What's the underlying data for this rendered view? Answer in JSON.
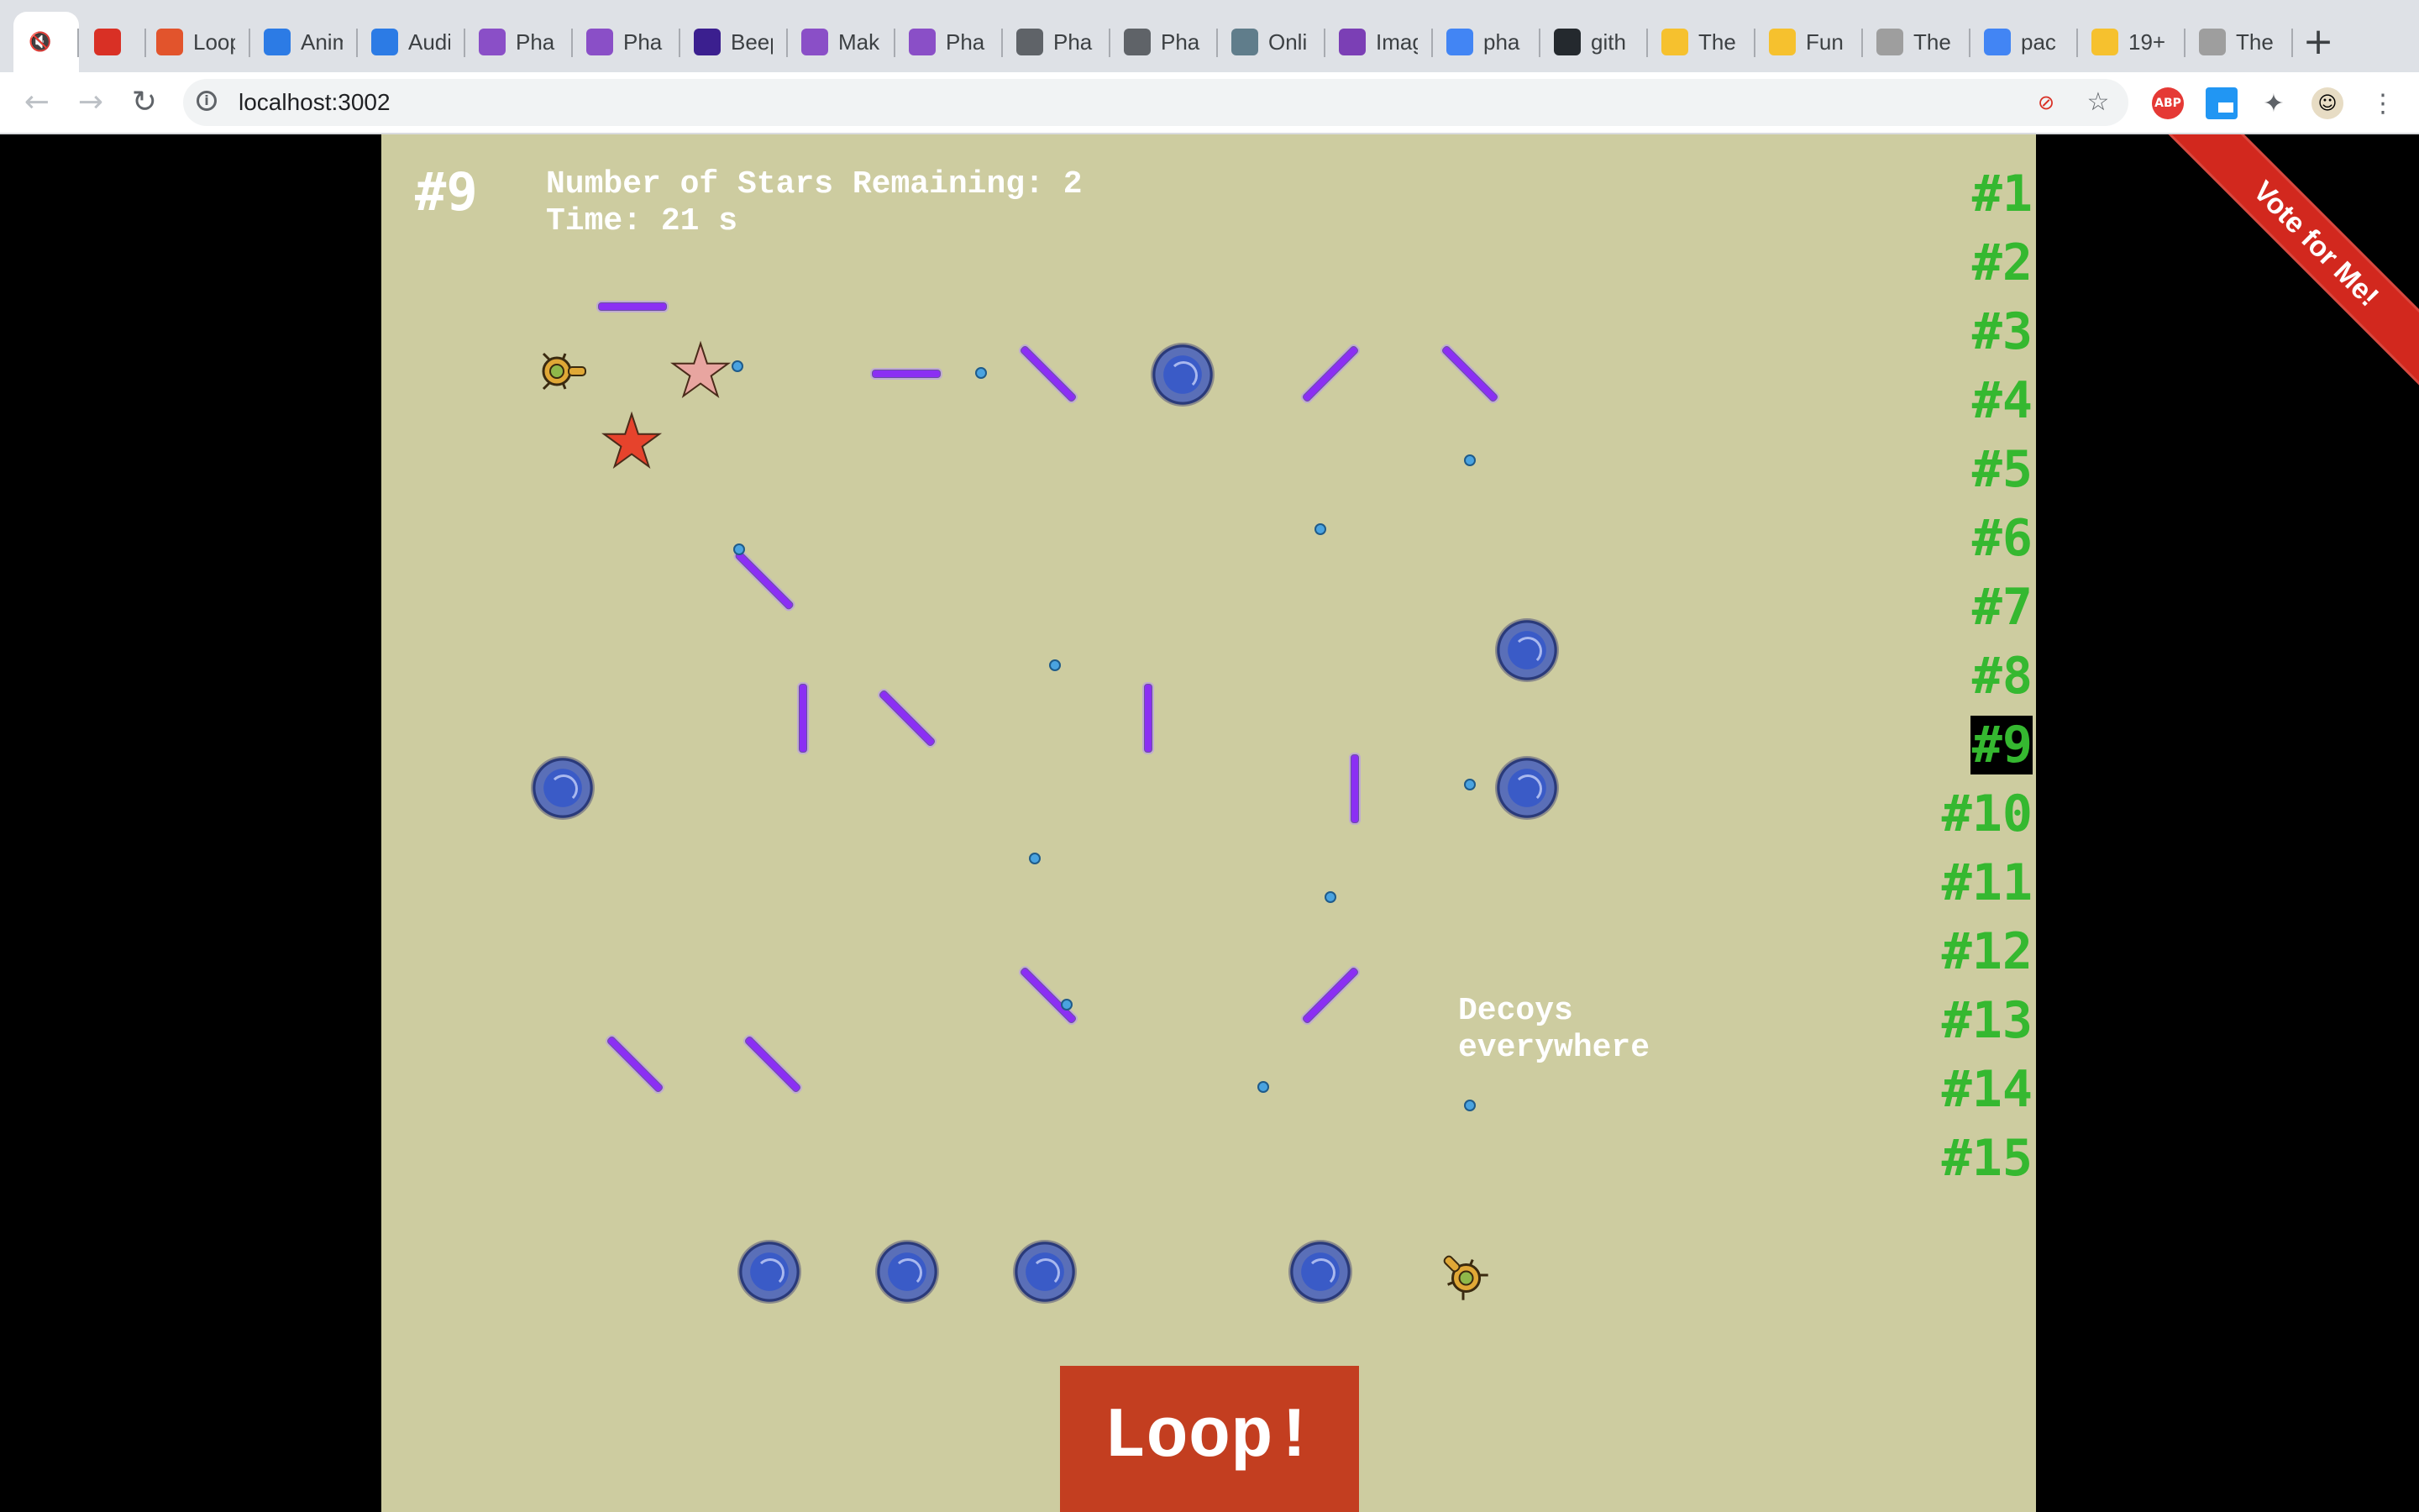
{
  "browser": {
    "tabs": [
      {
        "label": "",
        "icon": "muted-speaker-icon",
        "color": "#ffffff",
        "active": true
      },
      {
        "label": "",
        "icon": "heart-icon",
        "color": "#d93025"
      },
      {
        "label": "Loop",
        "icon": "ud-logo-icon",
        "color": "#e2542c"
      },
      {
        "label": "Anim",
        "icon": "puzzle-icon",
        "color": "#2c7be5"
      },
      {
        "label": "Audi",
        "icon": "puzzle-icon",
        "color": "#2c7be5"
      },
      {
        "label": "Pha",
        "icon": "phaser-icon",
        "color": "#8a4fc7"
      },
      {
        "label": "Pha",
        "icon": "phaser-icon",
        "color": "#8a4fc7"
      },
      {
        "label": "Beep",
        "icon": "ring-icon",
        "color": "#3b1f8f"
      },
      {
        "label": "Mak",
        "icon": "phaser-icon",
        "color": "#8a4fc7"
      },
      {
        "label": "Pha",
        "icon": "phaser-icon",
        "color": "#8a4fc7"
      },
      {
        "label": "Pha",
        "icon": "globe-icon",
        "color": "#5f6368"
      },
      {
        "label": "Pha",
        "icon": "globe-icon",
        "color": "#5f6368"
      },
      {
        "label": "Onli",
        "icon": "image-tool-icon",
        "color": "#607d8b"
      },
      {
        "label": "Imag",
        "icon": "jpg-icon",
        "color": "#7b3fb5"
      },
      {
        "label": "pha",
        "icon": "google-icon",
        "color": "#4285f4"
      },
      {
        "label": "gith",
        "icon": "github-icon",
        "color": "#24292e"
      },
      {
        "label": "The",
        "icon": "upside-down-face-icon",
        "color": "#f6c12e"
      },
      {
        "label": "Fun",
        "icon": "smiley-icon",
        "color": "#f6c12e"
      },
      {
        "label": "The",
        "icon": "troll-face-icon",
        "color": "#9e9e9e"
      },
      {
        "label": "pac",
        "icon": "google-icon",
        "color": "#4285f4"
      },
      {
        "label": "19+",
        "icon": "grin-icon",
        "color": "#f6c12e"
      },
      {
        "label": "The",
        "icon": "troll-face-icon",
        "color": "#9e9e9e"
      }
    ],
    "new_tab": "+",
    "url": "localhost:3002",
    "extensions": {
      "abp": "ABP"
    }
  },
  "game": {
    "level_badge": "#9",
    "stars_remaining": "Number of Stars Remaining: 2",
    "time": "Time: 21 s",
    "hint": "Decoys everywhere",
    "loop_button": "Loop!",
    "ribbon": "Vote for Me!",
    "current_level": 9,
    "levels": [
      "#1",
      "#2",
      "#3",
      "#4",
      "#5",
      "#6",
      "#7",
      "#8",
      "#9",
      "#10",
      "#11",
      "#12",
      "#13",
      "#14",
      "#15"
    ],
    "colors": {
      "background": "#cdcca0",
      "level_text": "#35b830",
      "loop_button": "#c33e20",
      "bar": "#8b2ff3",
      "ribbon": "#d2281e"
    }
  }
}
